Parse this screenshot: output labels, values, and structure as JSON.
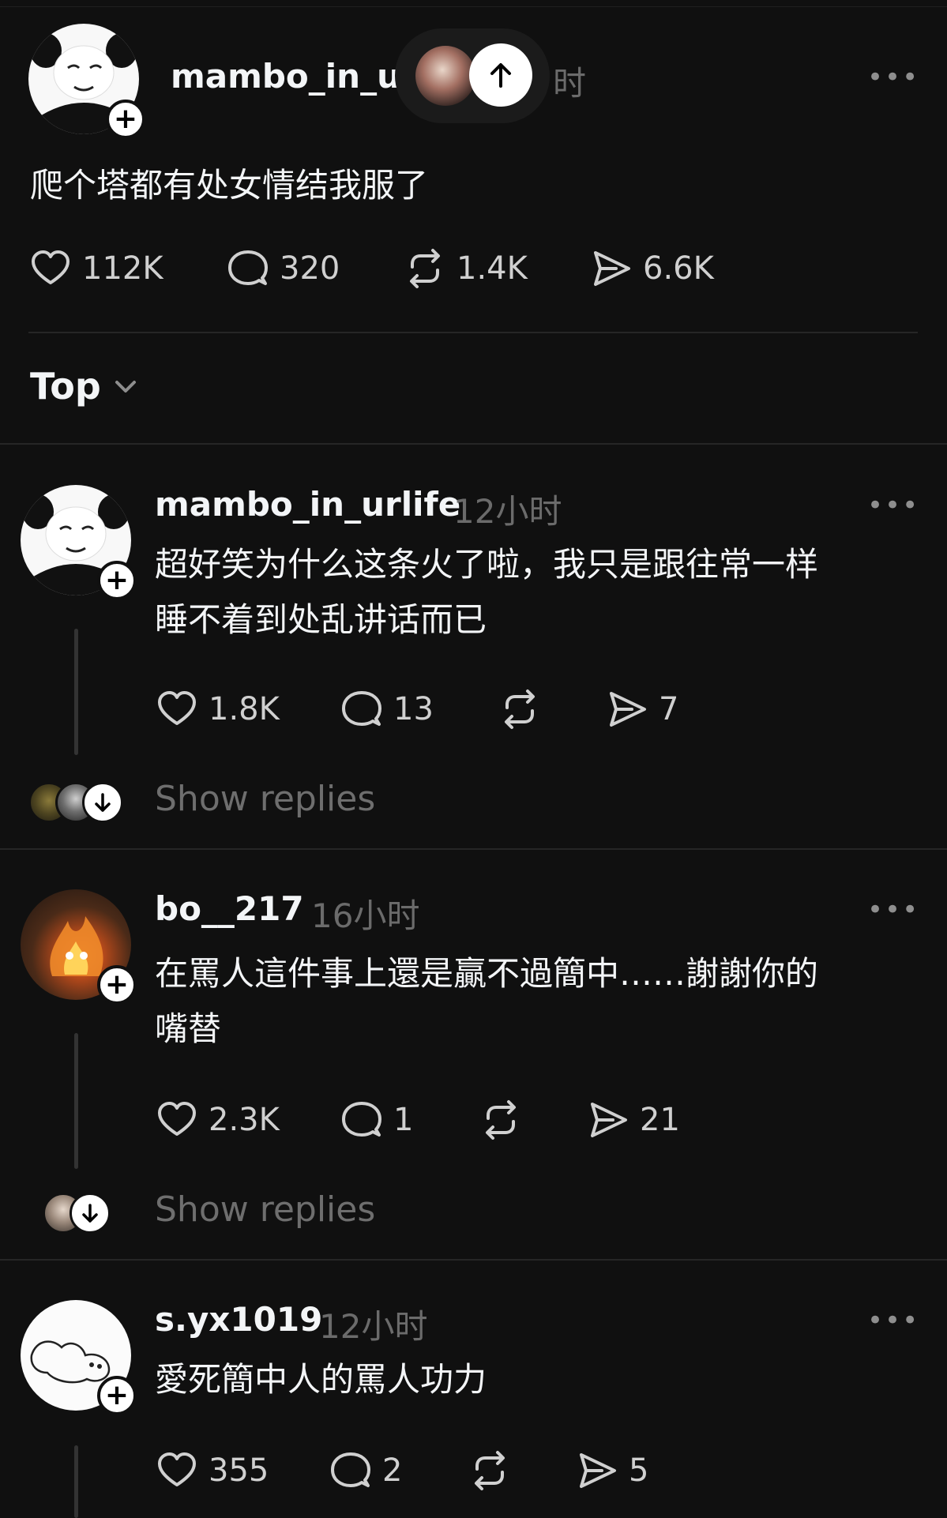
{
  "post": {
    "username": "mambo_in_ur",
    "time_tail": "时",
    "text": "爬个塔都有处女情结我服了",
    "likes": "112K",
    "comments": "320",
    "reposts": "1.4K",
    "shares": "6.6K"
  },
  "sort": {
    "label": "Top"
  },
  "replies": [
    {
      "username": "mambo_in_urlife",
      "time": "12小时",
      "text_line1": "超好笑为什么这条火了啦，我只是跟往常一样",
      "text_line2": "睡不着到处乱讲话而已",
      "likes": "1.8K",
      "comments": "13",
      "shares": "7",
      "show_replies": "Show replies"
    },
    {
      "username": "bo__217",
      "time": "16小时",
      "text_line1": "在罵人這件事上還是贏不過簡中……謝謝你的",
      "text_line2": "嘴替",
      "likes": "2.3K",
      "comments": "1",
      "shares": "21",
      "show_replies": "Show replies"
    },
    {
      "username": "s.yx1019",
      "time": "12小时",
      "text_line1": "愛死簡中人的罵人功力",
      "likes": "355",
      "comments": "2",
      "shares": "5"
    }
  ],
  "icons": {
    "like": "heart-icon",
    "comment": "comment-bubble-icon",
    "repost": "repost-icon",
    "share": "send-icon",
    "more": "more-horizontal-icon",
    "follow": "plus-icon",
    "scroll_up": "arrow-up-icon",
    "expand": "arrow-down-icon",
    "sort": "chevron-down-icon"
  },
  "more_glyph": "•••",
  "plus_glyph": "+"
}
